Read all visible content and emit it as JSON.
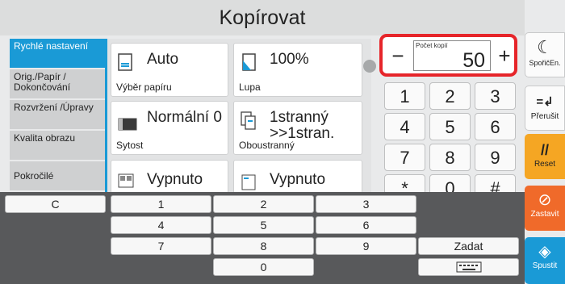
{
  "header": {
    "title": "Kopírovat"
  },
  "sidebar": {
    "items": [
      {
        "label": "Rychlé nastavení"
      },
      {
        "label": "Orig./Papír / Dokončování"
      },
      {
        "label": "Rozvržení /Úpravy"
      },
      {
        "label": "Kvalita obrazu"
      },
      {
        "label": "Pokročilé"
      }
    ]
  },
  "cards": {
    "paper": {
      "value": "Auto",
      "caption": "Výběr papíru"
    },
    "zoom": {
      "value": "100%",
      "caption": "Lupa"
    },
    "density": {
      "value": "Normální 0",
      "caption": "Sytost"
    },
    "duplex": {
      "value": "1stranný >>1stran.",
      "caption": "Oboustranný"
    },
    "combine": {
      "value": "Vypnuto"
    },
    "staple": {
      "value": "Vypnuto"
    }
  },
  "counter": {
    "label": "Počet kopií",
    "value": "50",
    "minus": "−",
    "plus": "+"
  },
  "keypad": {
    "keys": [
      "1",
      "2",
      "3",
      "4",
      "5",
      "6",
      "7",
      "8",
      "9",
      "*",
      "0",
      "#"
    ]
  },
  "right_buttons": {
    "sleep": "SpořičEn.",
    "interrupt": "Přerušit",
    "reset": "Reset",
    "stop": "Zastavit",
    "start": "Spustit"
  },
  "overlay_keypad": {
    "clear": "C",
    "keys": [
      "1",
      "2",
      "3",
      "4",
      "5",
      "6",
      "7",
      "8",
      "9",
      "0"
    ],
    "enter": "Zadat"
  },
  "colors": {
    "accent": "#1a9ad6",
    "reset": "#f5a623",
    "stop": "#f06a2a",
    "start": "#1a9ad6",
    "highlight": "#e6252a"
  }
}
